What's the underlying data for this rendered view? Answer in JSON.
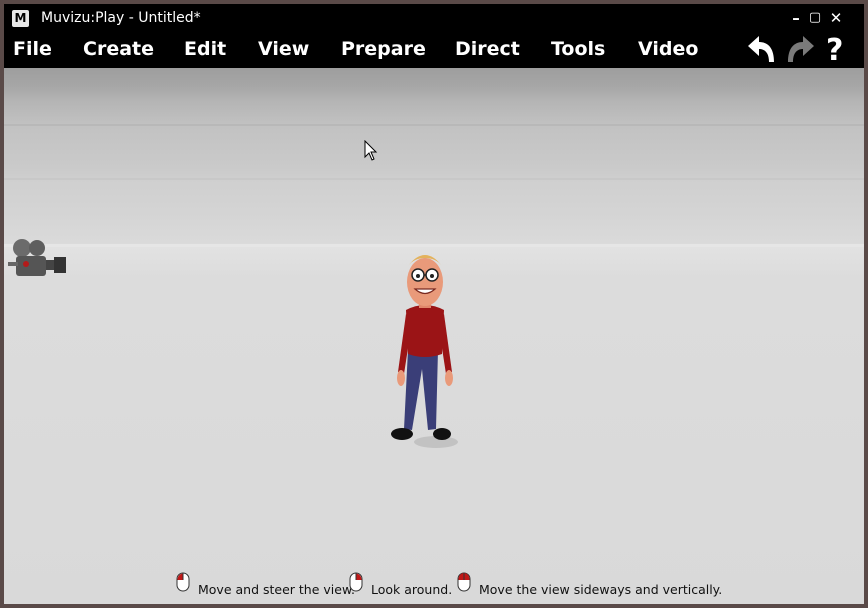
{
  "window": {
    "title": "Muvizu:Play - Untitled*",
    "app_icon_letter": "M",
    "controls": {
      "minimize": "–",
      "maximize": "▢",
      "close": "✕"
    }
  },
  "menu": {
    "items": [
      "File",
      "Create",
      "Edit",
      "View",
      "Prepare",
      "Direct",
      "Tools",
      "Video"
    ]
  },
  "toolbar": {
    "undo_icon": "undo-arrow-icon",
    "redo_icon": "redo-arrow-icon",
    "help_label": "?"
  },
  "hints": [
    {
      "text": "Move and steer the view.",
      "icon": "mouse-left-button-icon"
    },
    {
      "text": "Look around.",
      "icon": "mouse-right-button-icon"
    },
    {
      "text": "Move the view sideways and vertically.",
      "icon": "mouse-both-buttons-icon"
    }
  ],
  "colors": {
    "chrome": "#000000",
    "viewport_floor": "#d9d9d9",
    "character_shirt": "#9b1416",
    "character_pants": "#3a3e78"
  }
}
